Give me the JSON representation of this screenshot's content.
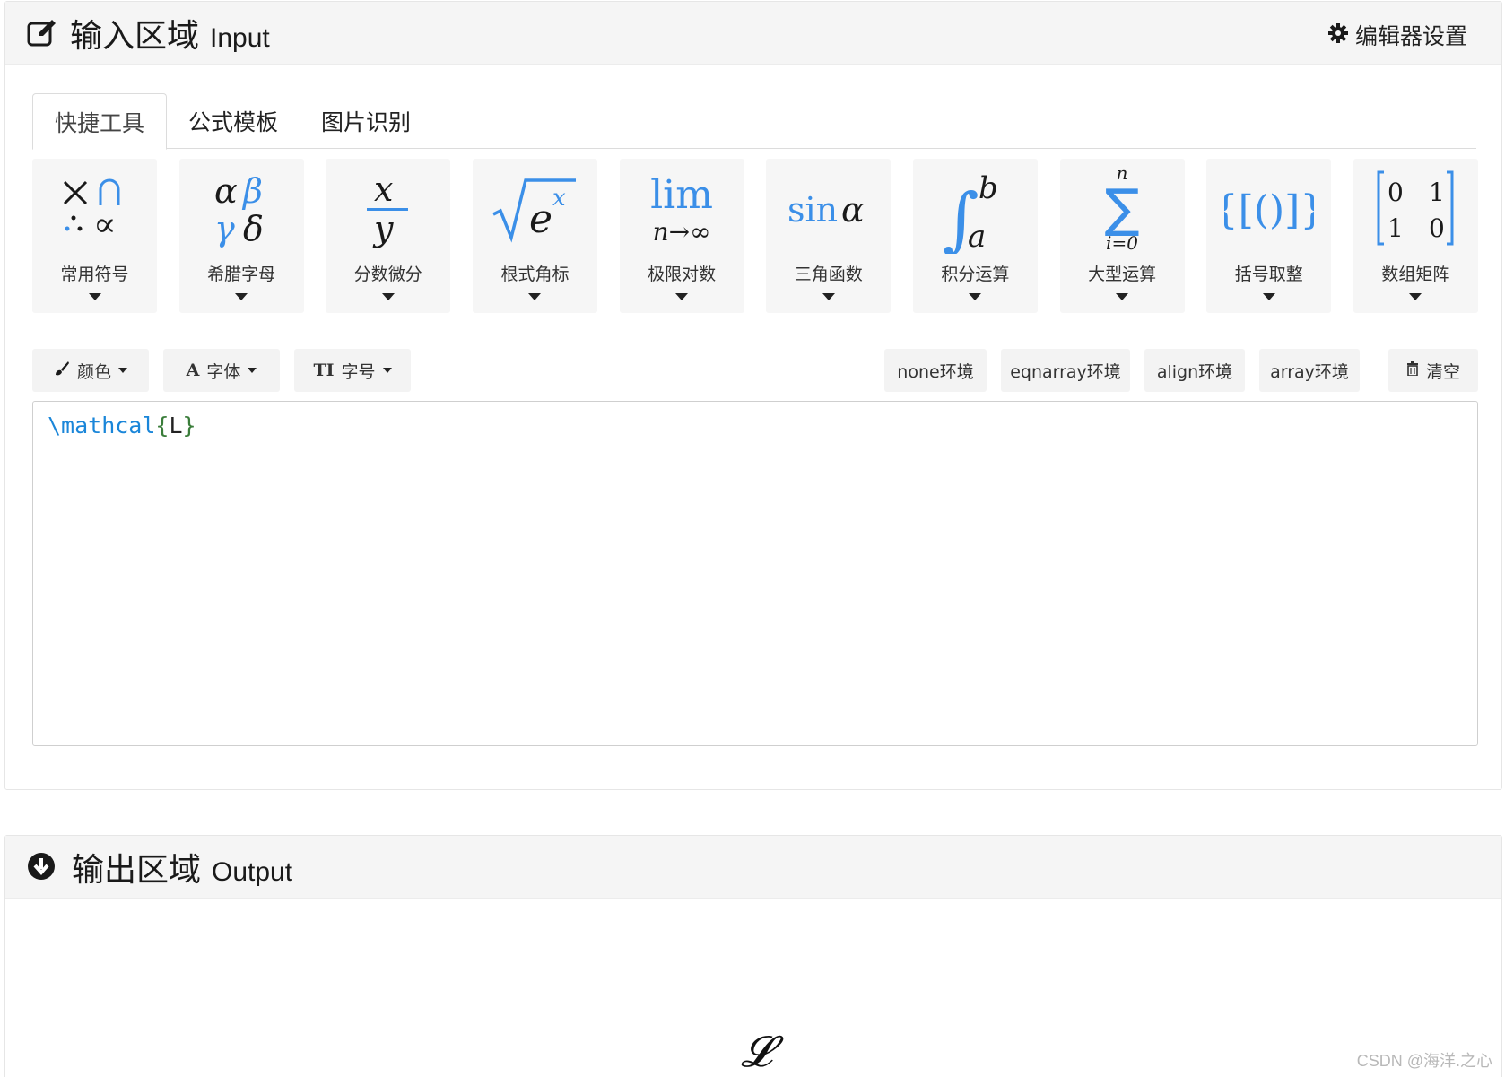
{
  "input_panel": {
    "title_cn": "输入区域",
    "title_en": "Input",
    "icon": "edit-icon",
    "settings_label": "编辑器设置",
    "settings_icon": "gear-icon"
  },
  "tabs": [
    {
      "label": "快捷工具",
      "active": true
    },
    {
      "label": "公式模板",
      "active": false
    },
    {
      "label": "图片识别",
      "active": false
    }
  ],
  "tools": [
    {
      "label": "常用符号",
      "icon": "common-symbols-icon"
    },
    {
      "label": "希腊字母",
      "icon": "greek-letters-icon"
    },
    {
      "label": "分数微分",
      "icon": "fraction-icon"
    },
    {
      "label": "根式角标",
      "icon": "radical-icon"
    },
    {
      "label": "极限对数",
      "icon": "limit-icon"
    },
    {
      "label": "三角函数",
      "icon": "trig-icon"
    },
    {
      "label": "积分运算",
      "icon": "integral-icon"
    },
    {
      "label": "大型运算",
      "icon": "summation-icon"
    },
    {
      "label": "括号取整",
      "icon": "brackets-icon"
    },
    {
      "label": "数组矩阵",
      "icon": "matrix-icon"
    }
  ],
  "toolbar": {
    "color_label": "颜色",
    "font_label": "字体",
    "font_icon_text": "A",
    "size_label": "字号",
    "size_icon_text": "TI",
    "env_none": "none环境",
    "env_eqnarray": "eqnarray环境",
    "env_align": "align环境",
    "env_array": "array环境",
    "clear_label": "清空"
  },
  "editor": {
    "cmd": "\\mathcal",
    "open_brace": "{",
    "arg": "L",
    "close_brace": "}"
  },
  "output_panel": {
    "title_cn": "输出区域",
    "title_en": "Output",
    "icon": "arrow-down-circle-icon",
    "rendered": "𝓛"
  },
  "watermark": "CSDN @海洋.之心",
  "colors": {
    "accent_blue": "#3b8fe8",
    "header_bg": "#f5f5f5",
    "tool_bg": "#f6f6f6"
  }
}
